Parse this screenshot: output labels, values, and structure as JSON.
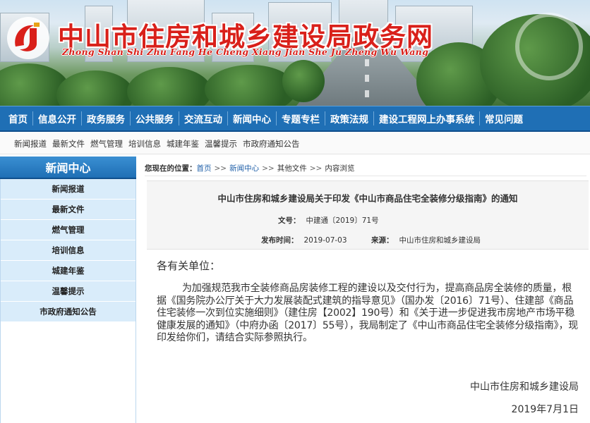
{
  "site": {
    "title": "中山市住房和城乡建设局政务网",
    "subtitle": "Zhong Shan Shi Zhu Fang He Cheng Xiang Jian She Ju Zheng Wu Wang",
    "brand_color": "#d9201a"
  },
  "main_nav": [
    "首页",
    "信息公开",
    "政务服务",
    "公共服务",
    "交流互动",
    "新闻中心",
    "专题专栏",
    "政策法规",
    "建设工程网上办事系统",
    "常见问题"
  ],
  "sub_nav": [
    "新闻报道",
    "最新文件",
    "燃气管理",
    "培训信息",
    "城建年鉴",
    "温馨提示",
    "市政府通知公告"
  ],
  "sidebar": {
    "heading": "新闻中心",
    "items": [
      "新闻报道",
      "最新文件",
      "燃气管理",
      "培训信息",
      "城建年鉴",
      "温馨提示",
      "市政府通知公告"
    ]
  },
  "breadcrumb": {
    "lead": "您现在的位置：",
    "items": [
      "首页",
      "新闻中心",
      "其他文件",
      "内容浏览"
    ],
    "separator": ">>"
  },
  "article": {
    "title": "中山市住房和城乡建设局关于印发《中山市商品住宅全装修分级指南》的通知",
    "doc_no_label": "文号：",
    "doc_no": "中建通〔2019〕71号",
    "date_label": "发布时间：",
    "date": "2019-07-03",
    "source_label": "来源：",
    "source": "中山市住房和城乡建设局",
    "greeting": "各有关单位：",
    "body": "为加强规范我市全装修商品房装修工程的建设以及交付行为，提高商品房全装修的质量，根据《国务院办公厅关于大力发展装配式建筑的指导意见》（国办发〔2016〕71号）、住建部《商品住宅装修一次到位实施细则》（建住房【2002】190号）和《关于进一步促进我市房地产市场平稳健康发展的通知》（中府办函〔2017〕55号），我局制定了《中山市商品住宅全装修分级指南》，现印发给你们，请结合实际参照执行。",
    "signature": "中山市住房和城乡建设局",
    "signature_date": "2019年7月1日"
  },
  "colors": {
    "nav_blue": "#1f6fb5",
    "sidebar_item_bg": "#d9ecfa"
  }
}
